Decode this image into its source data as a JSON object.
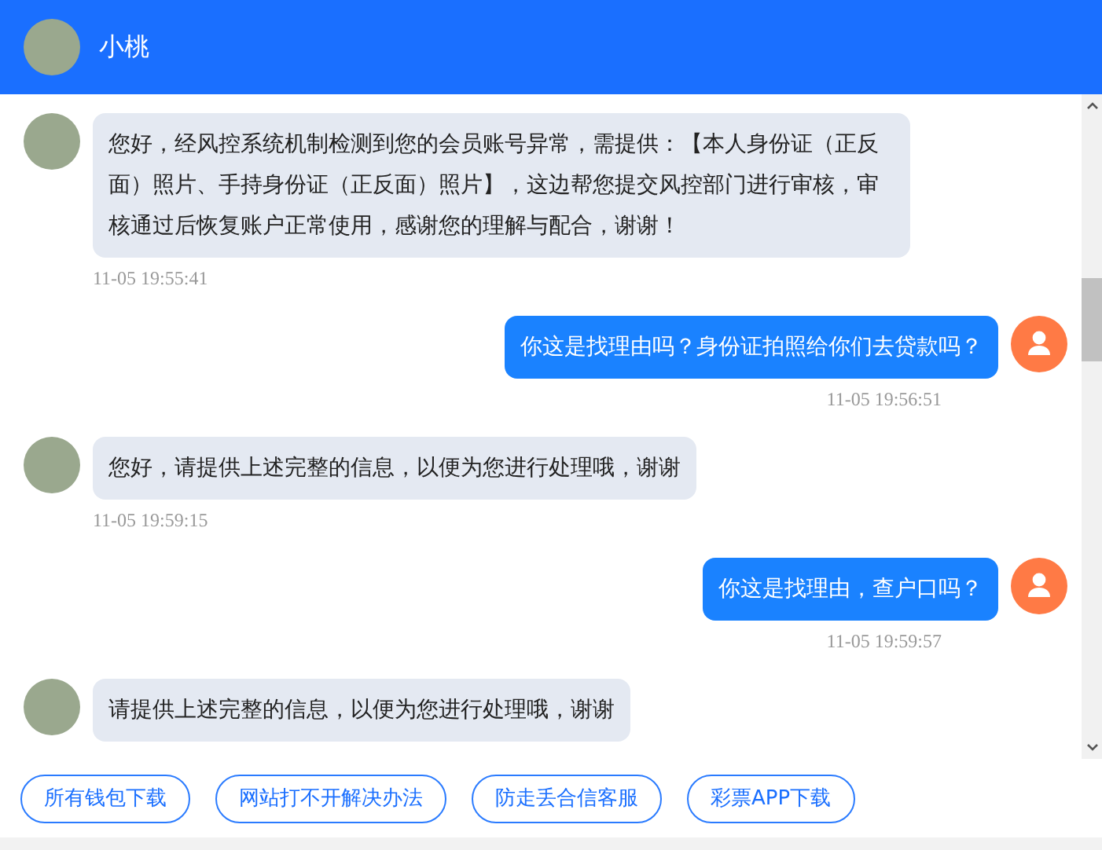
{
  "header": {
    "title": "小桃"
  },
  "messages": [
    {
      "kind": "agent",
      "text": "您好，经风控系统机制检测到您的会员账号异常，需提供：【本人身份证（正反面）照片、手持身份证（正反面）照片】，这边帮您提交风控部门进行审核，审核通过后恢复账户正常使用，感谢您的理解与配合，谢谢！",
      "time": "11-05 19:55:41"
    },
    {
      "kind": "user",
      "text": "你这是找理由吗？身份证拍照给你们去贷款吗？",
      "time": "11-05 19:56:51"
    },
    {
      "kind": "agent",
      "text": "您好，请提供上述完整的信息，以便为您进行处理哦，谢谢",
      "time": "11-05 19:59:15"
    },
    {
      "kind": "user",
      "text": "你这是找理由，查户口吗？",
      "time": "11-05 19:59:57"
    },
    {
      "kind": "agent",
      "text": "请提供上述完整的信息，以便为您进行处理哦，谢谢"
    }
  ],
  "quick_links": [
    "所有钱包下载",
    "网站打不开解决办法",
    "防走丢合信客服",
    "彩票APP下载"
  ]
}
